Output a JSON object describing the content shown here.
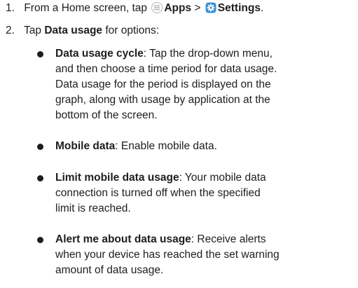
{
  "steps": [
    {
      "number": "1.",
      "prefix": "From a Home screen, tap",
      "apps_icon": "apps-grid-icon",
      "apps_label": "Apps",
      "separator": ">",
      "settings_icon": "settings-gear-icon",
      "settings_label": "Settings",
      "suffix": "."
    },
    {
      "number": "2.",
      "prefix": "Tap",
      "bold": "Data usage",
      "suffix": "for options:"
    }
  ],
  "bullets": [
    {
      "term": "Data usage cycle",
      "lines": [
        ": Tap the drop-down menu,",
        "and then choose a time period for data usage.",
        "Data usage for the period is displayed on the",
        "graph, along with usage by application at the",
        "bottom of the screen."
      ]
    },
    {
      "term": "Mobile data",
      "lines": [
        ": Enable mobile data."
      ]
    },
    {
      "term": "Limit mobile data usage",
      "lines": [
        ": Your mobile data",
        "connection is turned off when the specified",
        "limit is reached."
      ]
    },
    {
      "term": "Alert me about data usage",
      "lines": [
        ": Receive alerts",
        "when your device has reached the set warning",
        "amount of data usage."
      ]
    }
  ],
  "colors": {
    "text": "#1e1e1e",
    "settings_icon": "#3b8fd6",
    "apps_icon": "#9a9a9a"
  }
}
